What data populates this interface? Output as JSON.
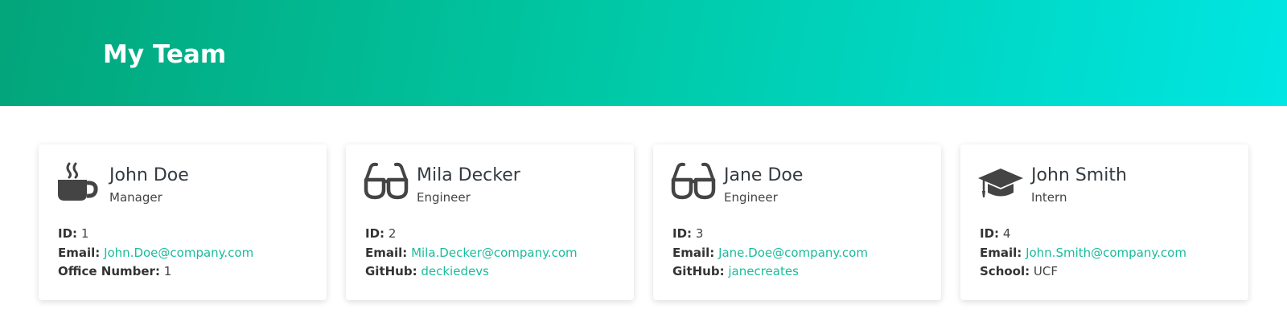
{
  "header": {
    "title": "My Team"
  },
  "colors": {
    "accent": "#1abc9c",
    "header_start": "#03a57a",
    "header_end": "#00e6e3",
    "icon": "#444444"
  },
  "cards": [
    {
      "name": "John Doe",
      "role": "Manager",
      "icon": "coffee-icon",
      "id_label": "ID:",
      "id": "1",
      "email_label": "Email:",
      "email": "John.Doe@company.com",
      "extra_label": "Office Number:",
      "extra": "1"
    },
    {
      "name": "Mila Decker",
      "role": "Engineer",
      "icon": "glasses-icon",
      "id_label": "ID:",
      "id": "2",
      "email_label": "Email:",
      "email": "Mila.Decker@company.com",
      "extra_label": "GitHub:",
      "extra": "deckiedevs"
    },
    {
      "name": "Jane Doe",
      "role": "Engineer",
      "icon": "glasses-icon",
      "id_label": "ID:",
      "id": "3",
      "email_label": "Email:",
      "email": "Jane.Doe@company.com",
      "extra_label": "GitHub:",
      "extra": "janecreates"
    },
    {
      "name": "John Smith",
      "role": "Intern",
      "icon": "graduation-cap-icon",
      "id_label": "ID:",
      "id": "4",
      "email_label": "Email:",
      "email": "John.Smith@company.com",
      "extra_label": "School:",
      "extra": "UCF"
    }
  ]
}
